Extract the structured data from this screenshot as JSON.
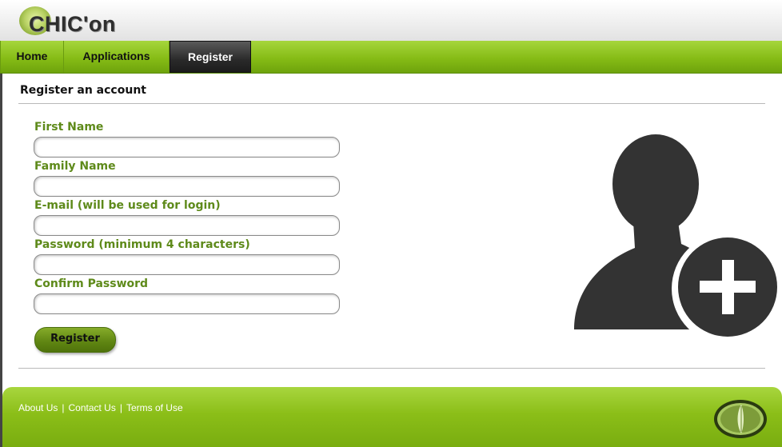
{
  "brand": {
    "logo_text": "CHIC'on",
    "accent": "#86bc16",
    "label_color": "#5e8a1a"
  },
  "nav": {
    "items": [
      {
        "label": "Home"
      },
      {
        "label": "Applications"
      },
      {
        "label": "Register",
        "active": true
      }
    ]
  },
  "page": {
    "heading": "Register an account"
  },
  "form": {
    "fields": [
      {
        "label": "First Name",
        "value": ""
      },
      {
        "label": "Family Name",
        "value": ""
      },
      {
        "label": "E-mail (will be used for login)",
        "value": ""
      },
      {
        "label": "Password (minimum 4 characters)",
        "value": ""
      },
      {
        "label": "Confirm Password",
        "value": ""
      }
    ],
    "submit_label": "Register"
  },
  "illustration": {
    "icon": "add-user-icon",
    "color": "#333333"
  },
  "footer": {
    "links": [
      {
        "label": "About Us"
      },
      {
        "label": "Contact Us"
      },
      {
        "label": "Terms of Use"
      }
    ],
    "separator": "|",
    "logo_icon": "leaf-logo-icon"
  }
}
